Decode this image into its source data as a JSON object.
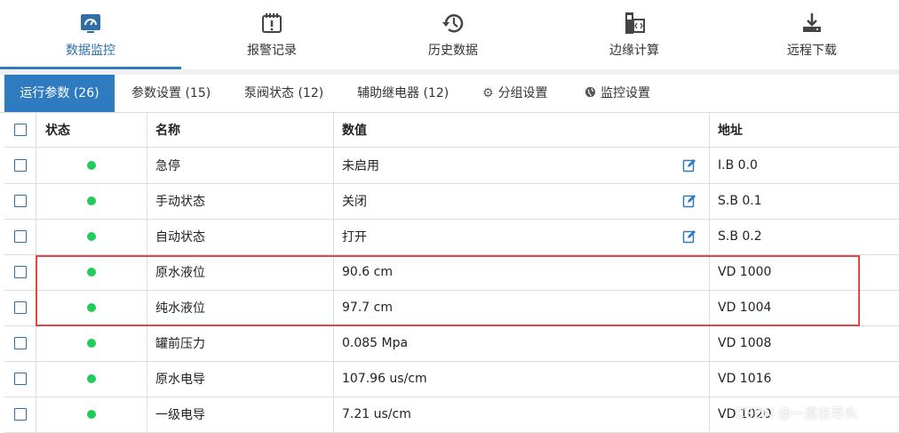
{
  "nav": {
    "items": [
      {
        "label": "数据监控",
        "icon": "dashboard-icon"
      },
      {
        "label": "报警记录",
        "icon": "alarm-icon"
      },
      {
        "label": "历史数据",
        "icon": "history-icon"
      },
      {
        "label": "边缘计算",
        "icon": "code-icon"
      },
      {
        "label": "远程下载",
        "icon": "download-icon"
      }
    ],
    "active_index": 0
  },
  "tabs": [
    {
      "label": "运行参数 (26)"
    },
    {
      "label": "参数设置 (15)"
    },
    {
      "label": "泵阀状态 (12)"
    },
    {
      "label": "辅助继电器 (12)"
    },
    {
      "label": "分组设置",
      "icon": "gear-icon"
    },
    {
      "label": "监控设置",
      "icon": "globe-icon"
    }
  ],
  "table": {
    "headers": {
      "status": "状态",
      "name": "名称",
      "value": "数值",
      "address": "地址"
    },
    "rows": [
      {
        "name": "急停",
        "value": "未启用",
        "address": "I.B 0.0",
        "editable": true
      },
      {
        "name": "手动状态",
        "value": "关闭",
        "address": "S.B 0.1",
        "editable": true
      },
      {
        "name": "自动状态",
        "value": "打开",
        "address": "S.B 0.2",
        "editable": true
      },
      {
        "name": "原水液位",
        "value": "90.6 cm",
        "address": "VD 1000",
        "editable": false
      },
      {
        "name": "纯水液位",
        "value": "97.7 cm",
        "address": "VD 1004",
        "editable": false
      },
      {
        "name": "罐前压力",
        "value": "0.085 Mpa",
        "address": "VD 1008",
        "editable": false
      },
      {
        "name": "原水电导",
        "value": "107.96 us/cm",
        "address": "VD 1016",
        "editable": false
      },
      {
        "name": "一级电导",
        "value": "7.21 us/cm",
        "address": "VD 1020",
        "editable": false
      }
    ]
  },
  "colors": {
    "accent": "#2f7bbf",
    "status_ok": "#22cc5a",
    "highlight": "#e0474a"
  },
  "watermark": "CSDN @一直在尽头"
}
